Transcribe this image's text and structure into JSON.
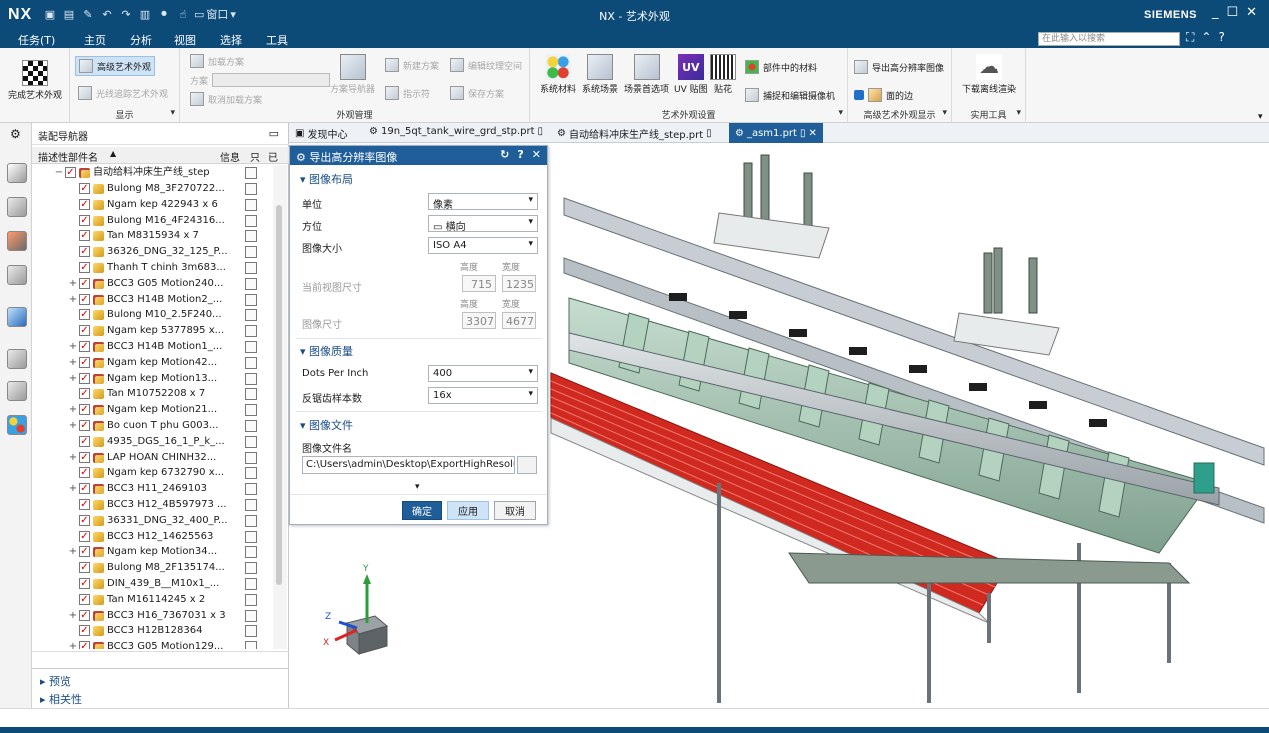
{
  "app": {
    "logo": "NX",
    "title": "NX - 艺术外观",
    "brand": "SIEMENS"
  },
  "quick_access": {
    "window_label": "窗口"
  },
  "menu": {
    "tabs": [
      "任务(T)",
      "主页",
      "分析",
      "视图",
      "选择",
      "工具"
    ],
    "active_tab": "主页",
    "search_placeholder": "在此输入以搜索"
  },
  "ribbon": {
    "finish": {
      "label": "完成艺术外观"
    },
    "display": {
      "advanced_studio": "高级艺术外观",
      "raytrace": "光线追踪艺术外观",
      "group": "显示"
    },
    "view_mgmt": {
      "load_scheme": "加载方案",
      "scheme_label": "方案",
      "cancel_load": "取消加载方案",
      "scheme_navigator": "方案导航器",
      "new_scheme": "新建方案",
      "edit_texture_space": "编辑纹理空间",
      "pointer": "指示符",
      "save_scheme": "保存方案",
      "group": "外观管理"
    },
    "studio_settings": {
      "items": [
        "系统材料",
        "系统场景",
        "场景首选项",
        "UV 贴图",
        "贴花"
      ],
      "part_materials": "部件中的材料",
      "capture_camera": "捕捉和编辑摄像机",
      "group": "艺术外观设置"
    },
    "advanced_display": {
      "export_hires": "导出高分辨率图像",
      "face_edges": "面的边",
      "group": "高级艺术外观显示"
    },
    "utilities": {
      "download_renderer": "下载离线渲染",
      "group": "实用工具"
    }
  },
  "navigator": {
    "title": "装配导航器",
    "columns": {
      "name": "描述性部件名",
      "info": "信息",
      "read_only": "只",
      "modified": "已"
    },
    "root": "自动给料冲床生产线_step",
    "items": [
      {
        "label": "Bulong M8_3F270722...",
        "expand": ""
      },
      {
        "label": "Ngam kep 422943 x 6",
        "expand": ""
      },
      {
        "label": "Bulong M16_4F24316...",
        "expand": ""
      },
      {
        "label": "Tan M8315934 x 7",
        "expand": ""
      },
      {
        "label": "36326_DNG_32_125_P...",
        "expand": ""
      },
      {
        "label": "Thanh T chinh 3m683...",
        "expand": ""
      },
      {
        "label": "BCC3 G05 Motion240...",
        "expand": "+"
      },
      {
        "label": "BCC3 H14B Motion2_...",
        "expand": "+"
      },
      {
        "label": "Bulong M10_2.5F240...",
        "expand": ""
      },
      {
        "label": "Ngam kep 5377895 x...",
        "expand": ""
      },
      {
        "label": "BCC3 H14B Motion1_...",
        "expand": "+"
      },
      {
        "label": "Ngam kep Motion42...",
        "expand": "+"
      },
      {
        "label": "Ngam kep Motion13...",
        "expand": "+"
      },
      {
        "label": "Tan M10752208 x 7",
        "expand": ""
      },
      {
        "label": "Ngam kep Motion21...",
        "expand": "+"
      },
      {
        "label": "Bo cuon T phu G003...",
        "expand": "+"
      },
      {
        "label": "4935_DGS_16_1_P_k_...",
        "expand": ""
      },
      {
        "label": "LAP HOAN CHINH32...",
        "expand": "+"
      },
      {
        "label": "Ngam kep 6732790 x...",
        "expand": ""
      },
      {
        "label": "BCC3 H11_2469103",
        "expand": "+"
      },
      {
        "label": "BCC3 H12_4B597973 ...",
        "expand": ""
      },
      {
        "label": "36331_DNG_32_400_P...",
        "expand": ""
      },
      {
        "label": "BCC3 H12_14625563",
        "expand": ""
      },
      {
        "label": "Ngam kep Motion34...",
        "expand": "+"
      },
      {
        "label": "Bulong M8_2F135174...",
        "expand": ""
      },
      {
        "label": "DIN_439_B__M10x1_...",
        "expand": ""
      },
      {
        "label": "Tan M16114245 x 2",
        "expand": ""
      },
      {
        "label": "BCC3 H16_7367031 x 3",
        "expand": "+"
      },
      {
        "label": "BCC3 H12B128364",
        "expand": ""
      },
      {
        "label": "BCC3 G05 Motion129...",
        "expand": "+"
      }
    ],
    "preview": "预览",
    "dependencies": "相关性"
  },
  "doc_tabs": [
    {
      "label": "发现中心",
      "active": false
    },
    {
      "label": "19n_5qt_tank_wire_grd_stp.prt",
      "active": false
    },
    {
      "label": "自动给料冲床生产线_step.prt",
      "active": false
    },
    {
      "label": "_asm1.prt",
      "active": true
    }
  ],
  "dialog": {
    "title": "导出高分辨率图像",
    "layout_section": "图像布局",
    "unit_label": "单位",
    "unit_value": "像素",
    "orientation_label": "方位",
    "orientation_value": "横向",
    "size_label": "图像大小",
    "size_value": "ISO A4",
    "height_hdr": "高度",
    "width_hdr": "宽度",
    "current_view_label": "当前视图尺寸",
    "current_height": "715",
    "current_width": "1235",
    "image_size_label": "图像尺寸",
    "image_height": "3307",
    "image_width": "4677",
    "quality_section": "图像质量",
    "dpi_label": "Dots Per Inch",
    "dpi_value": "400",
    "aa_label": "反锯齿样本数",
    "aa_value": "16x",
    "file_section": "图像文件",
    "filename_label": "图像文件名",
    "filename_value": "C:\\Users\\admin\\Desktop\\ExportHighResolutio",
    "ok": "确定",
    "apply": "应用",
    "cancel": "取消"
  },
  "triad": {
    "x": "X",
    "y": "Y",
    "z": "Z"
  },
  "colors": {
    "title_blue": "#0c4a78",
    "accent_blue": "#1f5e99",
    "rail_red": "#d02a20",
    "machine_green": "#a8c9b4"
  }
}
